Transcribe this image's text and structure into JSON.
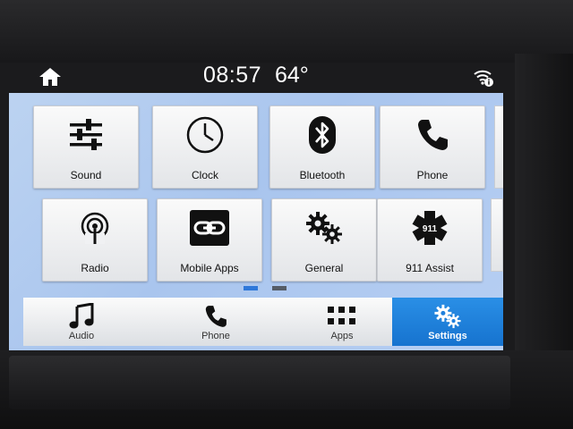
{
  "status": {
    "time": "08:57",
    "temperature": "64°"
  },
  "tiles": [
    {
      "label": "Sound",
      "icon": "sliders-icon"
    },
    {
      "label": "Clock",
      "icon": "clock-icon"
    },
    {
      "label": "Bluetooth",
      "icon": "bluetooth-icon"
    },
    {
      "label": "Phone",
      "icon": "phone-icon"
    },
    {
      "label": "Radio",
      "icon": "radio-antenna-icon"
    },
    {
      "label": "Mobile Apps",
      "icon": "link-icon"
    },
    {
      "label": "General",
      "icon": "gears-icon"
    },
    {
      "label": "911 Assist",
      "icon": "911-star-of-life-icon"
    }
  ],
  "page_indicator": {
    "current": 1,
    "total": 2
  },
  "nav": [
    {
      "label": "Audio",
      "icon": "music-note-icon",
      "active": false
    },
    {
      "label": "Phone",
      "icon": "phone-icon",
      "active": false
    },
    {
      "label": "Apps",
      "icon": "apps-grid-icon",
      "active": false
    },
    {
      "label": "Settings",
      "icon": "gears-icon",
      "active": true
    }
  ],
  "colors": {
    "accent": "#1f7fdc",
    "screen_bg": "#b0c9f0",
    "page_dot_active": "#2f78d9"
  }
}
